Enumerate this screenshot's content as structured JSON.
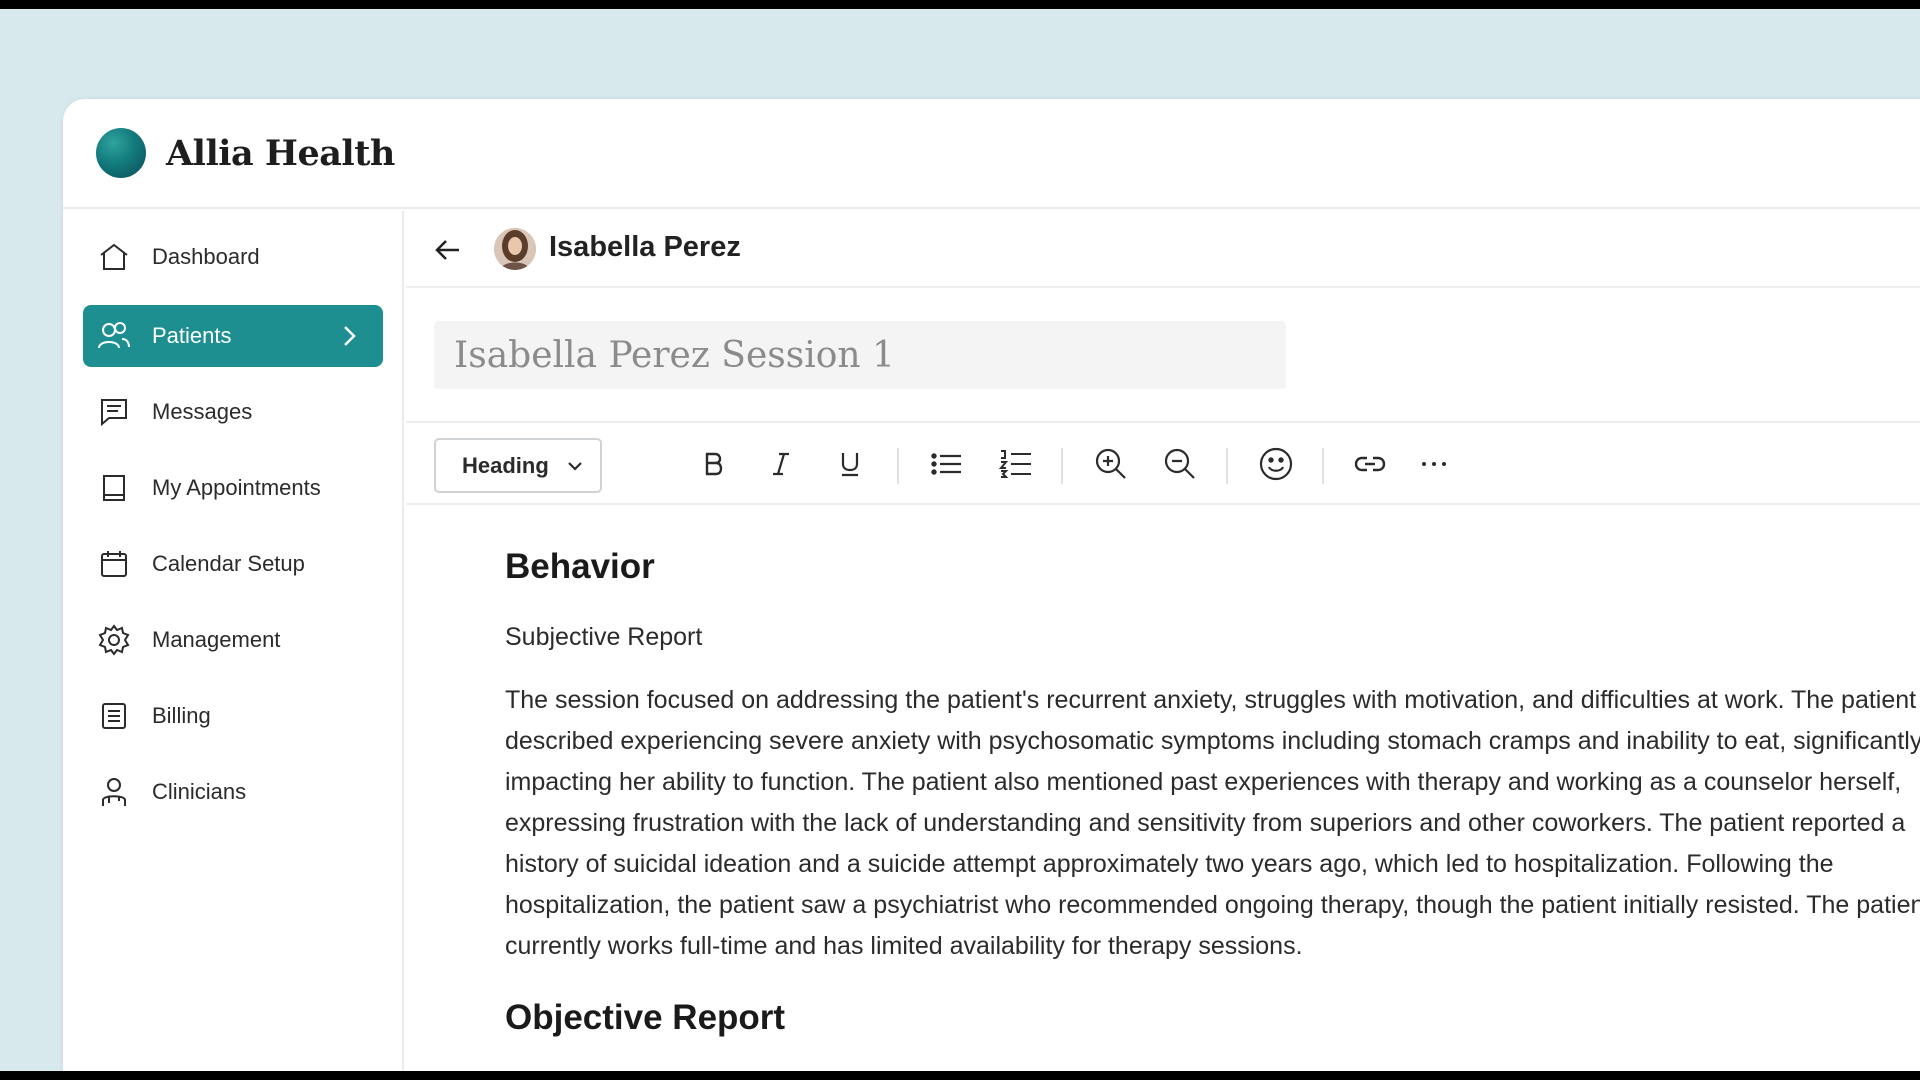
{
  "brand": {
    "name": "Allia Health"
  },
  "sidebar": {
    "items": [
      {
        "label": "Dashboard",
        "icon": "home-icon",
        "active": false
      },
      {
        "label": "Patients",
        "icon": "users-icon",
        "active": true
      },
      {
        "label": "Messages",
        "icon": "message-icon",
        "active": false
      },
      {
        "label": "My Appointments",
        "icon": "book-icon",
        "active": false
      },
      {
        "label": "Calendar Setup",
        "icon": "calendar-icon",
        "active": false
      },
      {
        "label": "Management",
        "icon": "gear-icon",
        "active": false
      },
      {
        "label": "Billing",
        "icon": "document-icon",
        "active": false
      },
      {
        "label": "Clinicians",
        "icon": "clinician-icon",
        "active": false
      }
    ]
  },
  "patient": {
    "name": "Isabella Perez"
  },
  "note": {
    "title_placeholder": "Isabella Perez Session 1"
  },
  "toolbar": {
    "block_type": "Heading",
    "buttons": [
      "bold-icon",
      "italic-icon",
      "underline-icon",
      "bullet-list-icon",
      "numbered-list-icon",
      "zoom-in-icon",
      "zoom-out-icon",
      "emoji-icon",
      "link-icon",
      "more-icon"
    ]
  },
  "document": {
    "section_heading": "Behavior",
    "subheading": "Subjective Report",
    "paragraph": "The session focused on addressing the patient's recurrent anxiety, struggles with motivation, and difficulties at work. The patient described experiencing severe anxiety with psychosomatic symptoms including stomach cramps and inability to eat, significantly impacting her ability to function. The patient also mentioned past experiences with therapy and working as a counselor herself, expressing frustration with the lack of understanding and sensitivity from superiors and other coworkers. The patient reported a history of suicidal ideation and a suicide attempt approximately two years ago, which led to hospitalization. Following the hospitalization, the patient saw a psychiatrist who recommended ongoing therapy, though the patient initially resisted. The patient currently works full-time and has limited availability for therapy sessions.",
    "next_heading": "Objective Report"
  },
  "colors": {
    "accent": "#1d8f91",
    "background": "#d7e9ed"
  }
}
